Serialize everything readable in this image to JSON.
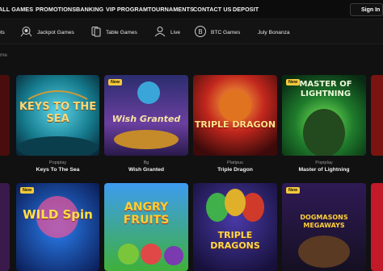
{
  "topnav": {
    "items": [
      "ALL GAMES",
      "PROMOTIONS",
      "BANKING",
      "VIP PROGRAM",
      "TOURNAMENTS",
      "CONTACT US",
      "DEPOSIT"
    ],
    "signin_label": "Sign In"
  },
  "categories": [
    {
      "label": "ots",
      "icon": "slots-icon"
    },
    {
      "label": "Jackpot Games",
      "icon": "jackpot-icon"
    },
    {
      "label": "Table Games",
      "icon": "cards-icon"
    },
    {
      "label": "Live",
      "icon": "live-dealer-icon"
    },
    {
      "label": "BTC Games",
      "icon": "bitcoin-icon"
    },
    {
      "label": "July Bonanza",
      "icon": ""
    }
  ],
  "breadcrumb": "me",
  "games_row1": [
    {
      "title": "Keys To The Sea",
      "provider": "Popiplay",
      "badge": "New",
      "art_text": "KEYS TO THE SEA"
    },
    {
      "title": "Wish Granted",
      "provider": "Bg",
      "badge": "New",
      "art_text": "Wish Granted"
    },
    {
      "title": "Triple Dragon",
      "provider": "Platipus",
      "badge": "",
      "art_text": "TRIPLE DRAGON"
    },
    {
      "title": "Master of Lightning",
      "provider": "Popiplay",
      "badge": "New",
      "art_text": "MASTER OF LIGHTNING"
    }
  ],
  "games_row2": [
    {
      "title": "",
      "provider": "",
      "badge": "New",
      "art_text": "WILD Spin"
    },
    {
      "title": "",
      "provider": "",
      "badge": "",
      "art_text": "ANGRY FRUITS"
    },
    {
      "title": "",
      "provider": "",
      "badge": "",
      "art_text": "TRIPLE DRAGONS"
    },
    {
      "title": "",
      "provider": "",
      "badge": "New",
      "art_text": "DOGMASONS MEGAWAYS"
    }
  ],
  "colors": {
    "background": "#111112",
    "badge": "#f3c93c",
    "nav_text": "#f2f2f2"
  }
}
